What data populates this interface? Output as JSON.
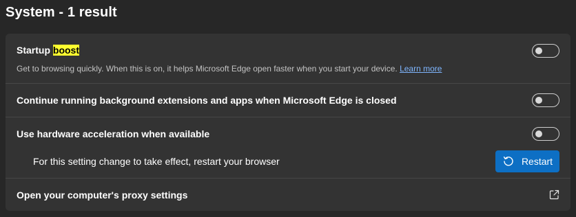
{
  "page": {
    "title": "System - 1 result"
  },
  "settings": {
    "startup_boost": {
      "label_prefix": "Startup ",
      "label_highlight": "boost",
      "description": "Get to browsing quickly. When this is on, it helps Microsoft Edge open faster when you start your device.",
      "learn_more": "Learn more",
      "toggle_state": "off"
    },
    "background_extensions": {
      "label": "Continue running background extensions and apps when Microsoft Edge is closed",
      "toggle_state": "off"
    },
    "hardware_acceleration": {
      "label": "Use hardware acceleration when available",
      "toggle_state": "off",
      "restart_note": "For this setting change to take effect, restart your browser",
      "restart_button": "Restart"
    },
    "proxy": {
      "label": "Open your computer's proxy settings"
    }
  },
  "colors": {
    "page_bg": "#272727",
    "card_bg": "#333333",
    "accent": "#0d6fc4",
    "search_highlight": "#ffff2f",
    "link": "#7fb6ff"
  },
  "icons": {
    "restart": "restart-icon",
    "external_link": "external-link-icon"
  }
}
